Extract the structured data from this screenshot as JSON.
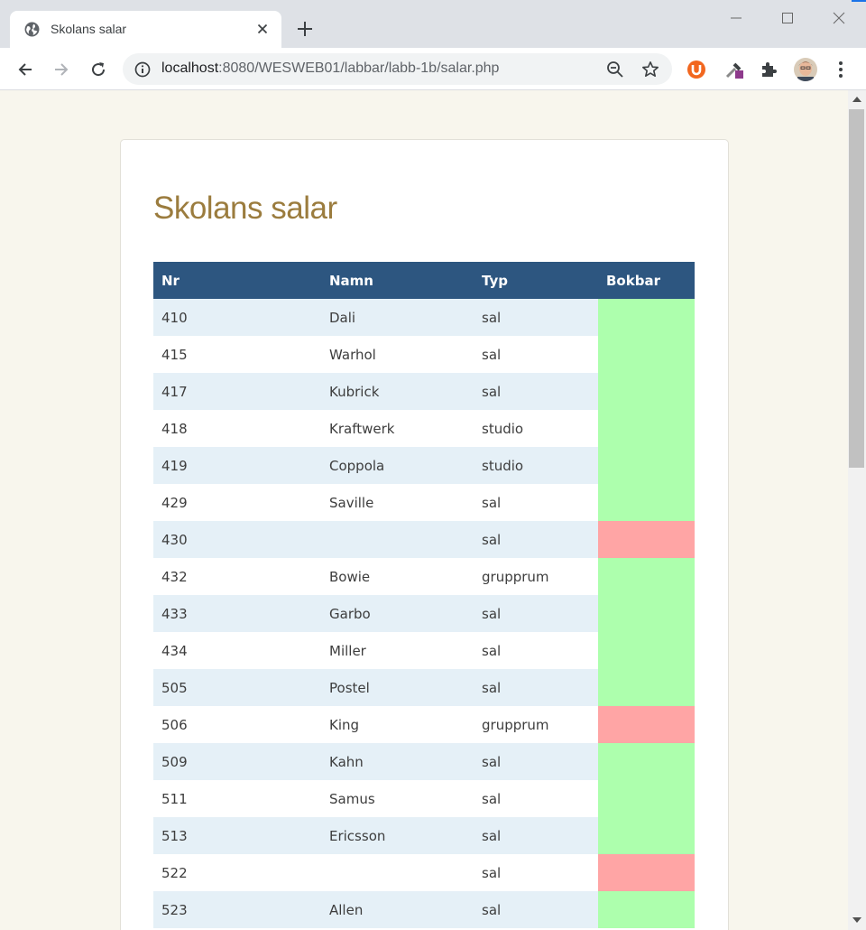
{
  "browser": {
    "tab_title": "Skolans salar",
    "url_host": "localhost",
    "url_rest": ":8080/WESWEB01/labbar/labb-1b/salar.php"
  },
  "page": {
    "title": "Skolans salar",
    "columns": [
      "Nr",
      "Namn",
      "Typ",
      "Bokbar"
    ],
    "rows": [
      {
        "nr": "410",
        "namn": "Dali",
        "typ": "sal",
        "bokbar": true
      },
      {
        "nr": "415",
        "namn": "Warhol",
        "typ": "sal",
        "bokbar": true
      },
      {
        "nr": "417",
        "namn": "Kubrick",
        "typ": "sal",
        "bokbar": true
      },
      {
        "nr": "418",
        "namn": "Kraftwerk",
        "typ": "studio",
        "bokbar": true
      },
      {
        "nr": "419",
        "namn": "Coppola",
        "typ": "studio",
        "bokbar": true
      },
      {
        "nr": "429",
        "namn": "Saville",
        "typ": "sal",
        "bokbar": true
      },
      {
        "nr": "430",
        "namn": "",
        "typ": "sal",
        "bokbar": false
      },
      {
        "nr": "432",
        "namn": "Bowie",
        "typ": "grupprum",
        "bokbar": true
      },
      {
        "nr": "433",
        "namn": "Garbo",
        "typ": "sal",
        "bokbar": true
      },
      {
        "nr": "434",
        "namn": "Miller",
        "typ": "sal",
        "bokbar": true
      },
      {
        "nr": "505",
        "namn": "Postel",
        "typ": "sal",
        "bokbar": true
      },
      {
        "nr": "506",
        "namn": "King",
        "typ": "grupprum",
        "bokbar": false
      },
      {
        "nr": "509",
        "namn": "Kahn",
        "typ": "sal",
        "bokbar": true
      },
      {
        "nr": "511",
        "namn": "Samus",
        "typ": "sal",
        "bokbar": true
      },
      {
        "nr": "513",
        "namn": "Ericsson",
        "typ": "sal",
        "bokbar": true
      },
      {
        "nr": "522",
        "namn": "",
        "typ": "sal",
        "bokbar": false
      },
      {
        "nr": "523",
        "namn": "Allen",
        "typ": "sal",
        "bokbar": true
      }
    ]
  },
  "colors": {
    "bookable": "#adffad",
    "not_bookable": "#ffa5a5",
    "header_bg": "#2d5680",
    "title": "#9b7c3e",
    "page_bg": "#f8f6ed"
  }
}
